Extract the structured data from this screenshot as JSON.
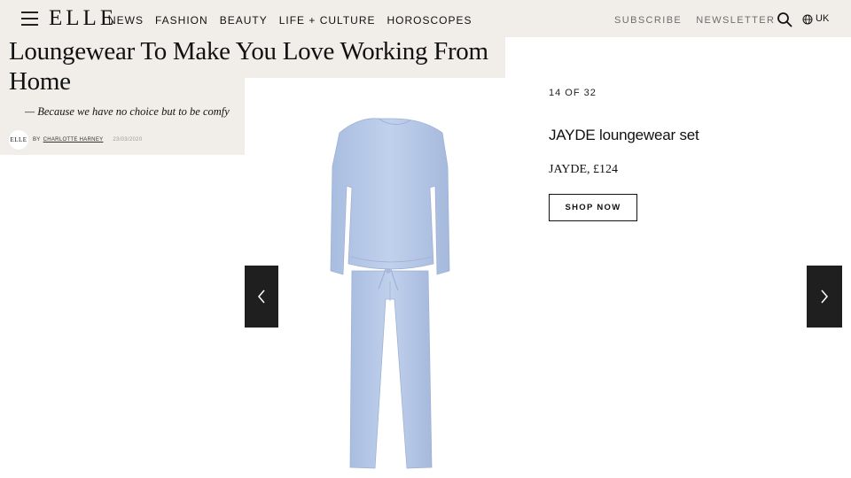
{
  "header": {
    "logo": "ELLE",
    "nav": [
      "NEWS",
      "FASHION",
      "BEAUTY",
      "LIFE + CULTURE",
      "HOROSCOPES"
    ],
    "subscribe": "SUBSCRIBE",
    "newsletter": "NEWSLETTER",
    "region": "UK",
    "icons": [
      "menu-icon",
      "search-icon",
      "globe-icon"
    ]
  },
  "article": {
    "headline": "Loungewear To Make You Love Working From Home",
    "standfirst": "— Because we have no choice but to be comfy",
    "avatar_text": "ELLE",
    "by": "BY",
    "author": "CHARLOTTE HARNEY",
    "date": "23/03/2020"
  },
  "gallery": {
    "counter": "14 OF 32",
    "product_name": "JAYDE loungewear set",
    "product_price": "JAYDE, £124",
    "shop_label": "SHOP NOW",
    "icons": [
      "chevron-left-icon",
      "chevron-right-icon"
    ],
    "product_color": "#b9cbe8"
  },
  "colors": {
    "header_bg": "#f1eee9",
    "arrow_bg": "#1f1f1f"
  }
}
